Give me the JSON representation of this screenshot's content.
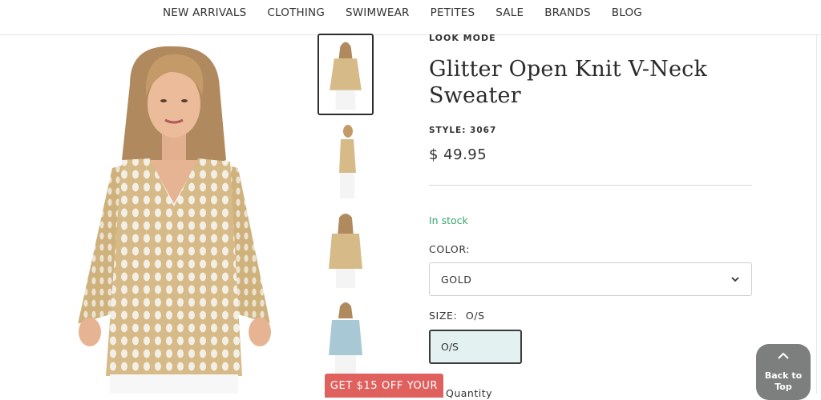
{
  "nav": {
    "items": [
      {
        "label": "NEW ARRIVALS"
      },
      {
        "label": "CLOTHING"
      },
      {
        "label": "SWIMWEAR"
      },
      {
        "label": "PETITES"
      },
      {
        "label": "SALE"
      },
      {
        "label": "BRANDS"
      },
      {
        "label": "BLOG"
      }
    ]
  },
  "product": {
    "brand": "LOOK MODE",
    "title": "Glitter Open Knit V-Neck Sweater",
    "style": "STYLE: 3067",
    "price": "$ 49.95",
    "stock": "In stock",
    "color_label": "COLOR:",
    "color_value": "GOLD",
    "size_label": "SIZE:",
    "size_selected": "O/S",
    "size_option": "O/S",
    "quantity_label": "Quantity"
  },
  "thumbnails": [
    {
      "name": "front",
      "color": "gold",
      "active": true
    },
    {
      "name": "side",
      "color": "gold",
      "active": false
    },
    {
      "name": "back",
      "color": "gold",
      "active": false
    },
    {
      "name": "front-blue",
      "color": "light-blue",
      "active": false
    }
  ],
  "promo": {
    "label": "GET $15 OFF YOUR"
  },
  "back_to_top": {
    "line1": "Back to",
    "line2": "Top"
  },
  "colors": {
    "in_stock": "#3aa56e",
    "promo": "#e0605e",
    "size_selected_bg": "#e3f1f1",
    "back_to_top_bg": "#7d7f7f",
    "sweater_gold": "#d8bd8b",
    "sweater_blue": "#a9c8d6"
  }
}
